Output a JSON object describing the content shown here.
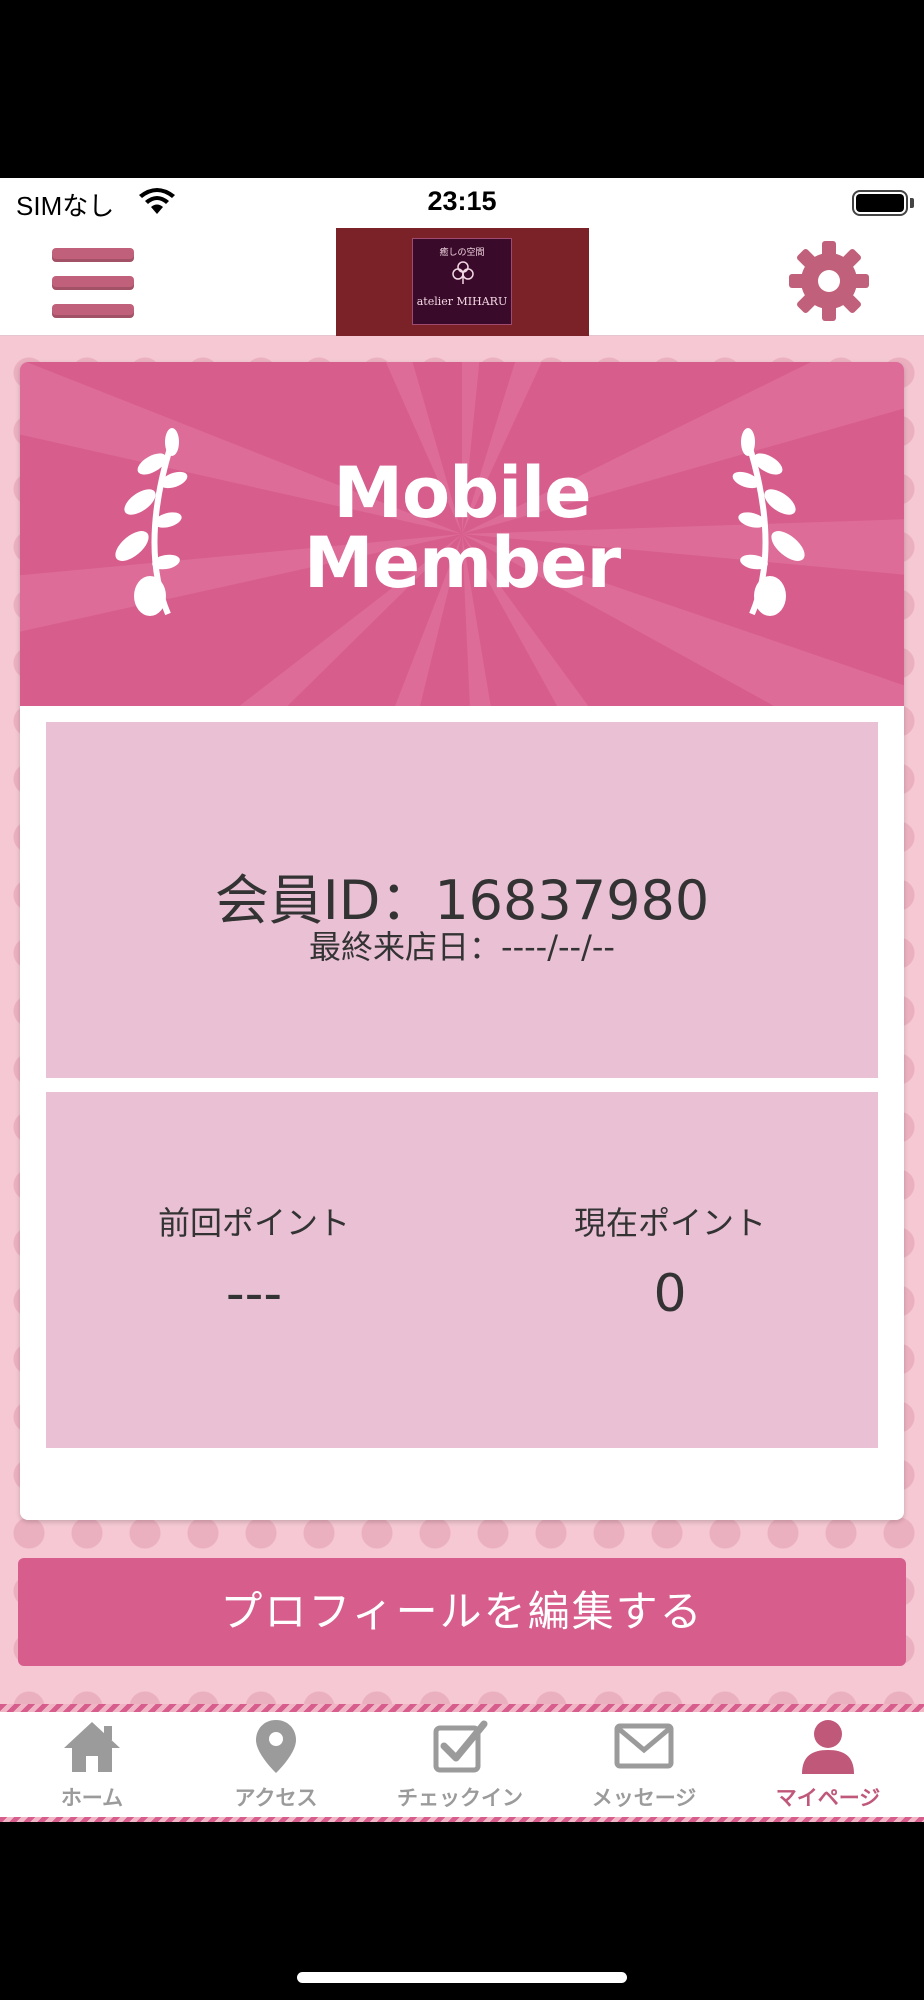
{
  "status_bar": {
    "carrier": "SIMなし",
    "time": "23:15"
  },
  "header": {
    "logo": {
      "tagline": "癒しの空間",
      "name": "atelier MIHARU"
    }
  },
  "card": {
    "title_line1": "Mobile",
    "title_line2": "Member",
    "member_id": "会員ID：16837980",
    "last_visit": "最終来店日：----/--/--",
    "points": {
      "previous_label": "前回ポイント",
      "previous_value": "---",
      "current_label": "現在ポイント",
      "current_value": "0"
    }
  },
  "edit_button_label": "プロフィールを編集する",
  "tabs": [
    {
      "label": "ホーム",
      "icon": "home-icon",
      "active": false
    },
    {
      "label": "アクセス",
      "icon": "map-pin-icon",
      "active": false
    },
    {
      "label": "チェックイン",
      "icon": "checkin-icon",
      "active": false
    },
    {
      "label": "メッセージ",
      "icon": "envelope-icon",
      "active": false
    },
    {
      "label": "マイページ",
      "icon": "user-icon",
      "active": true
    }
  ],
  "colors": {
    "accent": "#d75d8c",
    "panel": "#eac1d4",
    "background": "#f5c8d3",
    "tab_inactive": "#9b9b9b",
    "tab_active": "#c0587a"
  }
}
